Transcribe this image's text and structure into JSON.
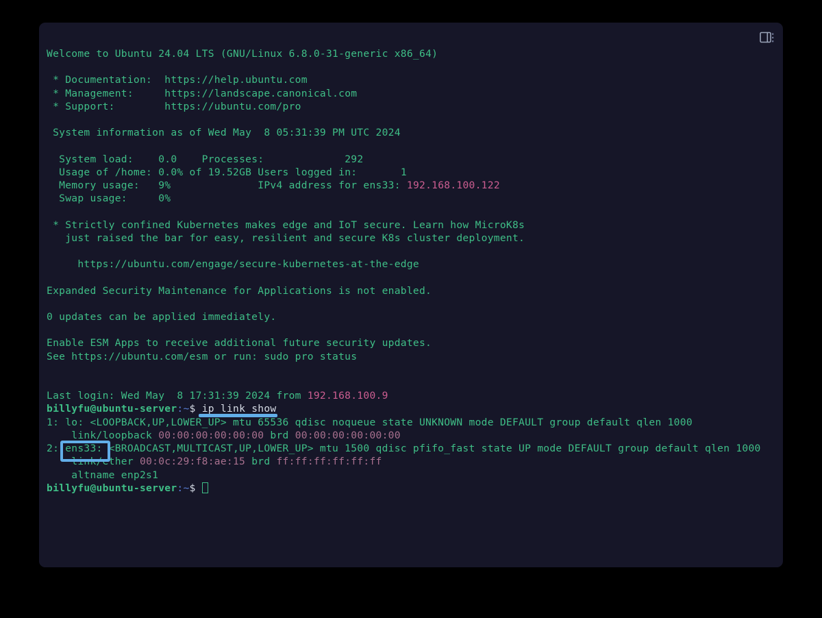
{
  "window": {
    "title": "Terminal",
    "panel_toggle_icon": "panel-layout-icon",
    "background_color": "#161628",
    "page_background_color": "#000000"
  },
  "colors": {
    "text_green": "#3fbf87",
    "magenta": "#cc5e91",
    "mac_magenta": "#a9718f",
    "white": "#d6dce6",
    "blue_path": "#5a7fd6",
    "annotation_blue": "#62aee8"
  },
  "motd": {
    "welcome": "Welcome to Ubuntu 24.04 LTS (GNU/Linux 6.8.0-31-generic x86_64)",
    "links": [
      {
        "label": " * Documentation:",
        "pad": "  ",
        "url": "https://help.ubuntu.com"
      },
      {
        "label": " * Management:",
        "pad": "     ",
        "url": "https://landscape.canonical.com"
      },
      {
        "label": " * Support:",
        "pad": "        ",
        "url": "https://ubuntu.com/pro"
      }
    ],
    "sysinfo_header": " System information as of Wed May  8 05:31:39 PM UTC 2024",
    "stats": [
      {
        "left_label": "  System load:",
        "left_pad": "    ",
        "left_value": "0.0",
        "right_label": "Processes:",
        "right_pad": "             ",
        "right_value": "292",
        "right_value_color": "green"
      },
      {
        "left_label": "  Usage of /home:",
        "left_pad": " ",
        "left_value": "0.0% of 19.52GB",
        "right_label": "Users logged in:",
        "right_pad": "       ",
        "right_value": "1",
        "right_value_color": "green"
      },
      {
        "left_label": "  Memory usage:",
        "left_pad": "   ",
        "left_value": "9%",
        "right_label": "IPv4 address for ens33:",
        "right_pad": " ",
        "right_value": "192.168.100.122",
        "right_value_color": "magenta"
      },
      {
        "left_label": "  Swap usage:",
        "left_pad": "     ",
        "left_value": "0%",
        "right_label": "",
        "right_pad": "",
        "right_value": "",
        "right_value_color": "green"
      }
    ],
    "promo_line_1": " * Strictly confined Kubernetes makes edge and IoT secure. Learn how MicroK8s",
    "promo_line_2": "   just raised the bar for easy, resilient and secure K8s cluster deployment.",
    "promo_url": "     https://ubuntu.com/engage/secure-kubernetes-at-the-edge",
    "esm_notice": "Expanded Security Maintenance for Applications is not enabled.",
    "updates_notice": "0 updates can be applied immediately.",
    "esm_enable_line_1": "Enable ESM Apps to receive additional future security updates.",
    "esm_enable_line_2": "See https://ubuntu.com/esm or run: sudo pro status"
  },
  "session": {
    "last_login_prefix": "Last login: Wed May  8 17:31:39 2024 from ",
    "last_login_ip": "192.168.100.9",
    "prompt_user_host": "billyfu@ubuntu-server",
    "prompt_path": ":~",
    "prompt_symbol": "$",
    "command": "ip link show"
  },
  "command_output": {
    "lines": [
      {
        "segments": [
          {
            "text": "1: lo: <LOOPBACK,UP,LOWER_UP> mtu 65536 qdisc noqueue state UNKNOWN mode DEFAULT group default qlen 1000",
            "color": "green"
          }
        ]
      },
      {
        "segments": [
          {
            "text": "    link/loopback ",
            "color": "green"
          },
          {
            "text": "00:00:00:00:00:00",
            "color": "mac"
          },
          {
            "text": " brd ",
            "color": "green"
          },
          {
            "text": "00:00:00:00:00:00",
            "color": "mac"
          }
        ]
      },
      {
        "segments": [
          {
            "text": "2: ens33: <BROADCAST,MULTICAST,UP,LOWER_UP> mtu 1500 qdisc pfifo_fast state UP mode DEFAULT group default qlen 1000",
            "color": "green"
          }
        ]
      },
      {
        "segments": [
          {
            "text": "    link/ether ",
            "color": "green"
          },
          {
            "text": "00:0c:29:f8:ae:15",
            "color": "mac"
          },
          {
            "text": " brd ",
            "color": "green"
          },
          {
            "text": "ff:ff:ff:ff:ff:ff",
            "color": "mac"
          }
        ]
      },
      {
        "segments": [
          {
            "text": "    altname enp2s1",
            "color": "green"
          }
        ]
      }
    ]
  },
  "final_prompt": {
    "user_host": "billyfu@ubuntu-server",
    "path": ":~",
    "symbol": "$"
  },
  "annotations": [
    {
      "type": "underline",
      "target": "command-ip-link-show",
      "label": "ip link show"
    },
    {
      "type": "box",
      "target": "interface-name-ens33",
      "label": "ens33:"
    }
  ]
}
